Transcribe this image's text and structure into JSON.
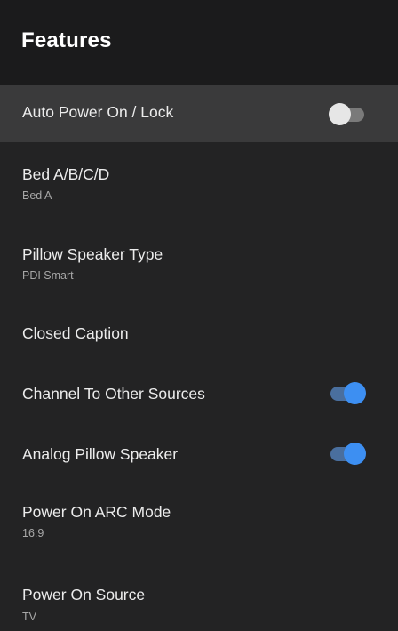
{
  "header": {
    "title": "Features"
  },
  "items": [
    {
      "title": "Auto Power On / Lock",
      "toggle": "off"
    },
    {
      "title": "Bed A/B/C/D",
      "value": "Bed A"
    },
    {
      "title": "Pillow Speaker Type",
      "value": "PDI Smart"
    },
    {
      "title": "Closed Caption"
    },
    {
      "title": "Channel To Other Sources",
      "toggle": "on"
    },
    {
      "title": "Analog Pillow Speaker",
      "toggle": "on"
    },
    {
      "title": "Power On ARC Mode",
      "value": "16:9"
    },
    {
      "title": "Power On Source",
      "value": "TV"
    }
  ]
}
